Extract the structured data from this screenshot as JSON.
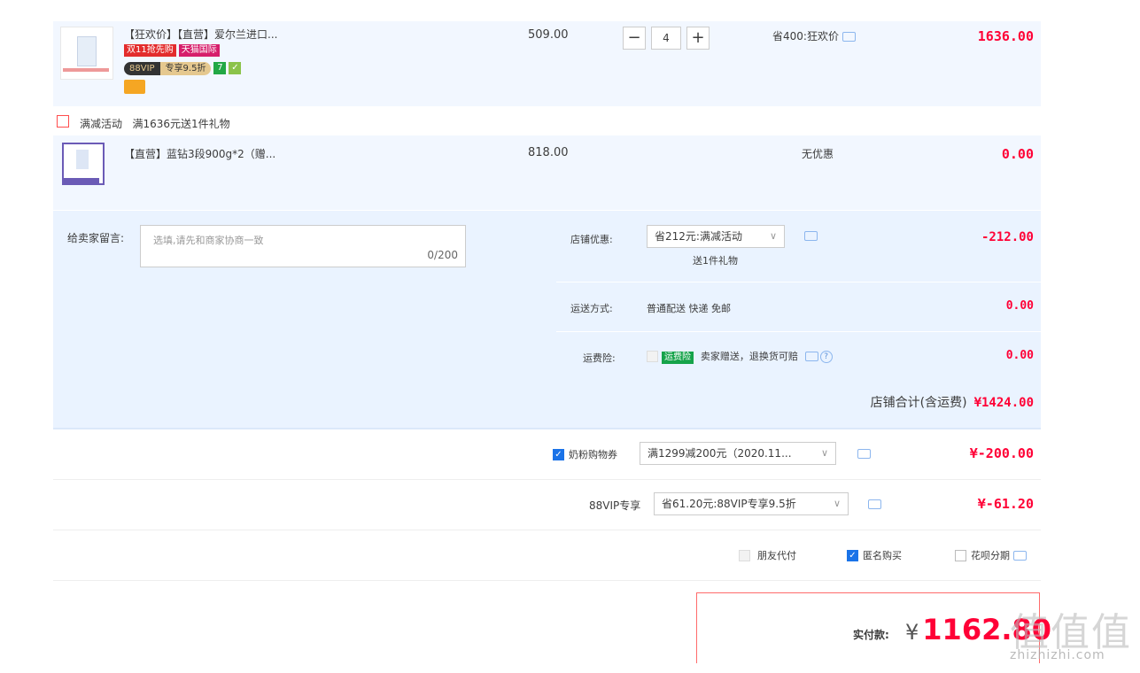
{
  "items": [
    {
      "title": "【狂欢价】【直营】爱尔兰进口...",
      "tags": [
        "双11抢先购",
        "天猫国际"
      ],
      "vip_a": "88VIP",
      "vip_b": "专享9.5折",
      "price": "509.00",
      "qty": "4",
      "promo": "省400:狂欢价",
      "sum": "1636.00"
    },
    {
      "title": "【直营】蓝钻3段900g*2（赠...",
      "price": "818.00",
      "promo": "无优惠",
      "sum": "0.00"
    }
  ],
  "gift": {
    "label": "满减活动",
    "text": "满1636元送1件礼物"
  },
  "message": {
    "label": "给卖家留言:",
    "placeholder": "选填,请先和商家协商一致",
    "count": "0/200"
  },
  "shop_discount": {
    "label": "店铺优惠:",
    "value": "省212元:满减活动",
    "note": "送1件礼物",
    "amount": "-212.00"
  },
  "shipping": {
    "label": "运送方式:",
    "value": "普通配送 快递 免邮",
    "amount": "0.00"
  },
  "insurance": {
    "label": "运费险:",
    "tag": "运费险",
    "text": "卖家赠送，退换货可赔",
    "amount": "0.00"
  },
  "shop_total": {
    "label": "店铺合计(含运费)",
    "value": "¥1424.00"
  },
  "coupon": {
    "label": "奶粉购物券",
    "value": "满1299减200元（2020.11...",
    "amount": "¥-200.00"
  },
  "vip88": {
    "label": "88VIP专享",
    "value": "省61.20元:88VIP专享9.5折",
    "amount": "¥-61.20"
  },
  "options": {
    "friend_pay": "朋友代付",
    "anonymous": "匿名购买",
    "huabei": "花呗分期"
  },
  "payment": {
    "label": "实付款:",
    "currency": "¥",
    "value": "1162.80"
  },
  "watermark": {
    "main": "值值值",
    "site": "zhizhizhi.com"
  }
}
